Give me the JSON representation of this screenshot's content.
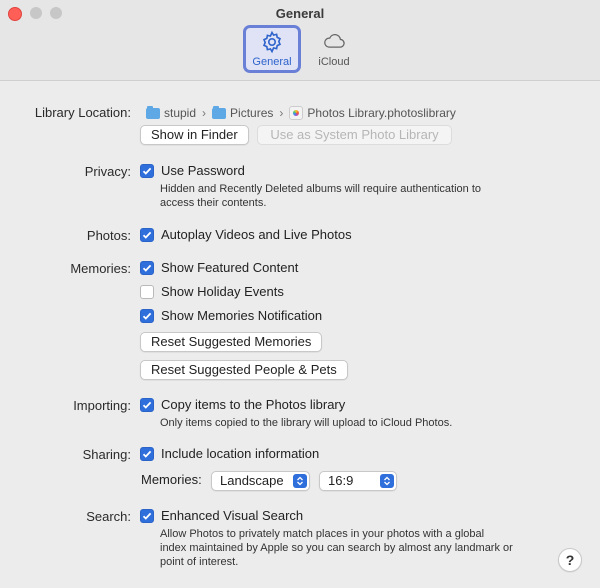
{
  "window": {
    "title": "General"
  },
  "tabs": [
    {
      "label": "General",
      "icon": "gear-icon",
      "active": true
    },
    {
      "label": "iCloud",
      "icon": "cloud-icon",
      "active": false
    }
  ],
  "library": {
    "label": "Library Location:",
    "path": [
      "stupid",
      "Pictures",
      "Photos Library.photoslibrary"
    ],
    "show_in_finder": "Show in Finder",
    "use_as_system": "Use as System Photo Library"
  },
  "privacy": {
    "label": "Privacy:",
    "use_password": "Use Password",
    "desc_line1": "Hidden and Recently Deleted albums will require authentication to",
    "desc_line2": "access their contents."
  },
  "photos": {
    "label": "Photos:",
    "autoplay": "Autoplay Videos and Live Photos"
  },
  "memories": {
    "label": "Memories:",
    "featured": "Show Featured Content",
    "holiday": "Show Holiday Events",
    "notification": "Show Memories Notification",
    "reset_memories": "Reset Suggested Memories",
    "reset_people": "Reset Suggested People & Pets"
  },
  "importing": {
    "label": "Importing:",
    "copy_items": "Copy items to the Photos library",
    "desc": "Only items copied to the library will upload to iCloud Photos."
  },
  "sharing": {
    "label": "Sharing:",
    "include_location": "Include location information",
    "memories_label": "Memories:",
    "orientation": "Landscape",
    "aspect": "16:9"
  },
  "search": {
    "label": "Search:",
    "enhanced": "Enhanced Visual Search",
    "desc_line1": "Allow Photos to privately match places in your photos with a global",
    "desc_line2": "index maintained by Apple so you can search by almost any landmark or",
    "desc_line3": "point of interest."
  },
  "help": {
    "label": "?"
  },
  "colors": {
    "accent": "#2f6fdc",
    "close": "#ff5f57"
  }
}
